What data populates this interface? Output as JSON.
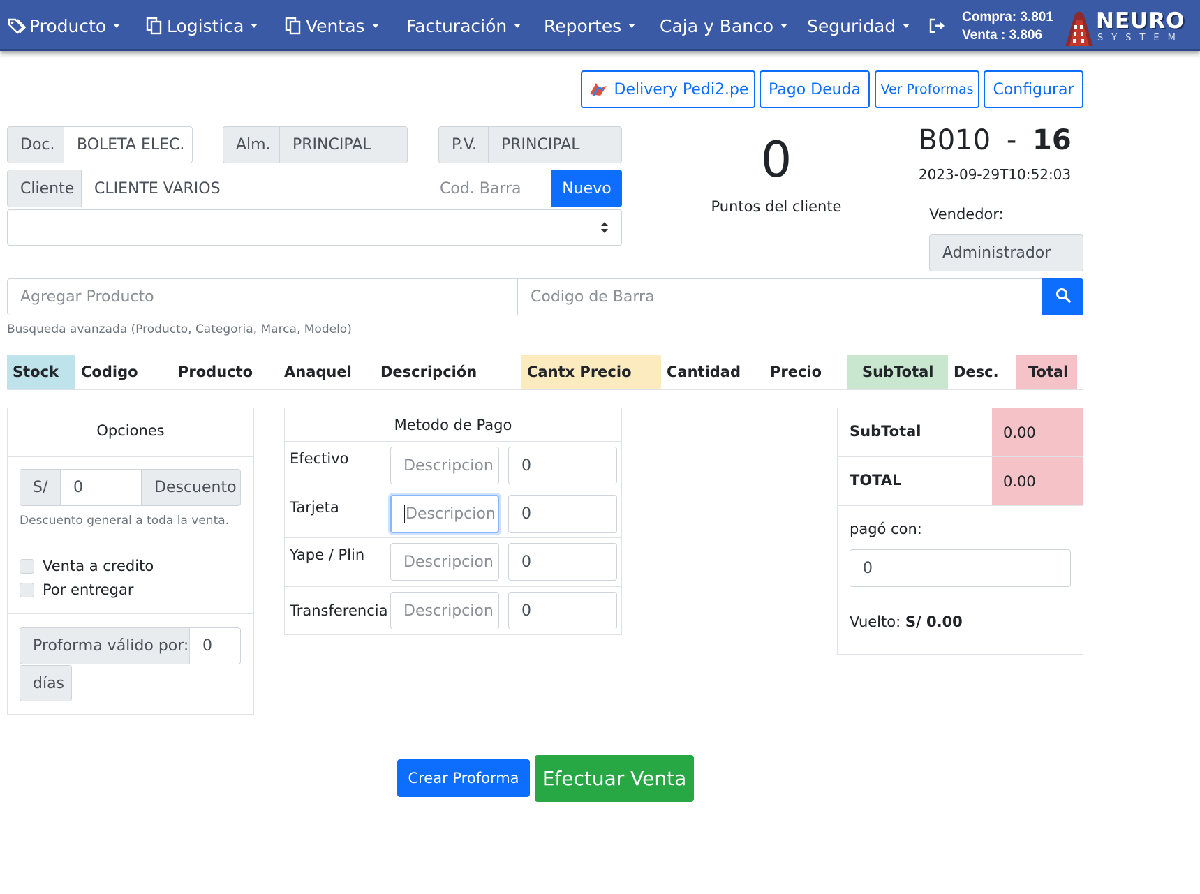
{
  "nav": {
    "items": [
      {
        "label": "Producto",
        "icon": "tags-icon"
      },
      {
        "label": "Logistica",
        "icon": "copy-icon"
      },
      {
        "label": "Ventas",
        "icon": "file-icon"
      },
      {
        "label": "Facturación"
      },
      {
        "label": "Reportes"
      },
      {
        "label": "Caja y Banco"
      },
      {
        "label": "Seguridad"
      }
    ],
    "logout_icon": "sign-out-icon",
    "compra": "Compra: 3.801",
    "venta": "Venta : 3.806",
    "logo_text": "NEURO",
    "logo_sub": "SYSTEM"
  },
  "toolbar": {
    "delivery": "Delivery Pedi2.pe",
    "pago_deuda": "Pago Deuda",
    "ver_proformas": "Ver Proformas",
    "configurar": "Configurar"
  },
  "form": {
    "doc_label": "Doc.",
    "doc_value": "BOLETA ELEC.",
    "alm_label": "Alm.",
    "alm_value": "PRINCIPAL",
    "pv_label": "P.V.",
    "pv_value": "PRINCIPAL",
    "cliente_label": "Cliente",
    "cliente_value": "CLIENTE VARIOS",
    "cod_barra_placeholder": "Cod. Barra",
    "nuevo": "Nuevo",
    "select_value": ""
  },
  "points": {
    "value": "0",
    "label": "Puntos del cliente"
  },
  "document": {
    "serie": "B010",
    "separator": "-",
    "numero": "16",
    "datetime": "2023-09-29T10:52:03",
    "vendedor_label": "Vendedor:",
    "vendedor_value": "Administrador"
  },
  "search": {
    "producto_placeholder": "Agregar Producto",
    "barra_placeholder": "Codigo de Barra",
    "helper": "Busqueda avanzada (Producto, Categoria, Marca, Modelo)"
  },
  "table": {
    "headers": [
      "Stock",
      "Codigo",
      "Producto",
      "Anaquel",
      "Descripción",
      "Cantx Precio",
      "Cantidad",
      "Precio",
      "SubTotal",
      "Desc.",
      "Total"
    ],
    "colors": {
      "stock": "#bfe3ea",
      "cantx": "#fdebc0",
      "subtotal": "#c9e7cf",
      "total": "#f5c2c7"
    }
  },
  "options": {
    "title": "Opciones",
    "currency": "S/",
    "discount_value": "0",
    "discount_btn": "Descuento",
    "discount_help": "Descuento general a toda la venta.",
    "venta_credito": "Venta a credito",
    "por_entregar": "Por entregar",
    "proforma_label": "Proforma válido por:",
    "proforma_value": "0",
    "dias": "días"
  },
  "payment": {
    "title": "Metodo de Pago",
    "rows": [
      {
        "label": "Efectivo",
        "placeholder": "Descripcion",
        "amount": "0"
      },
      {
        "label": "Tarjeta",
        "placeholder": "Descripcion",
        "amount": "0"
      },
      {
        "label": "Yape / Plin",
        "placeholder": "Descripcion",
        "amount": "0"
      },
      {
        "label": "Transferencia",
        "placeholder": "Descripcion",
        "amount": "0"
      }
    ]
  },
  "summary": {
    "subtotal_label": "SubTotal",
    "subtotal_value": "0.00",
    "total_label": "TOTAL",
    "total_value": "0.00",
    "pago_con_label": "pagó con:",
    "pago_con_value": "0",
    "vuelto_label": "Vuelto:",
    "vuelto_value": "S/ 0.00"
  },
  "actions": {
    "crear_proforma": "Crear Proforma",
    "efectuar_venta": "Efectuar Venta"
  }
}
